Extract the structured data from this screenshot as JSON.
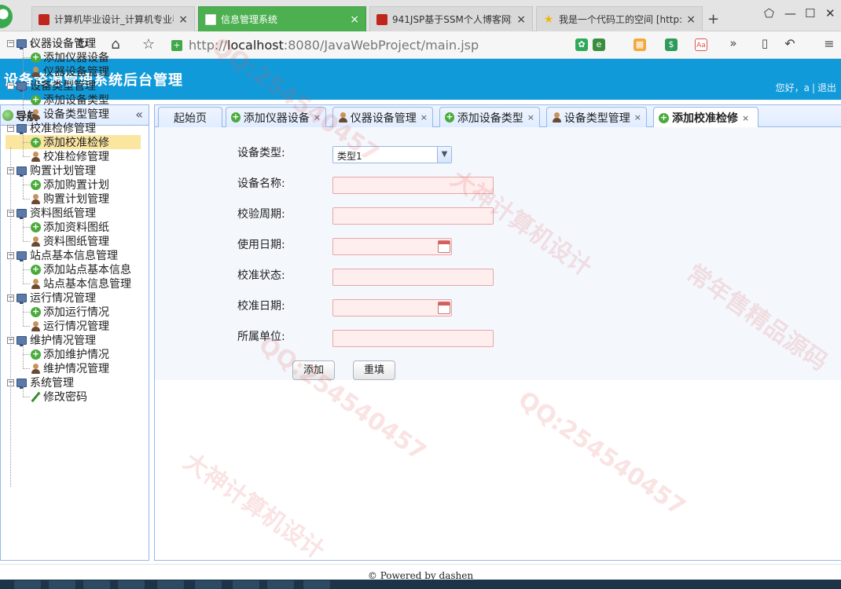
{
  "browser": {
    "tabs": [
      {
        "title": "计算机毕业设计_计算机专业毕",
        "favicon": "red-square-icon",
        "active": false
      },
      {
        "title": "信息管理系统",
        "favicon": "document-icon",
        "active": true
      },
      {
        "title": "941JSP基于SSM个人博客网站",
        "favicon": "red-square-icon",
        "active": false
      },
      {
        "title": "我是一个代码工的空间 [http:",
        "favicon": "star-icon",
        "active": false
      }
    ],
    "new_tab": "+",
    "url_prefix": "http://",
    "url_host": "localhost",
    "url_rest": ":8080/JavaWebProject/main.jsp"
  },
  "header": {
    "title": "设备资源管理系统后台管理",
    "greeting": "您好，a",
    "separator": "|",
    "logout": "退出"
  },
  "sidebar": {
    "title": "导航",
    "collapse": "«",
    "groups": [
      {
        "label": "仪器设备管理",
        "items": [
          {
            "label": "添加仪器设备",
            "icon": "add-icon"
          },
          {
            "label": "仪器设备管理",
            "icon": "user-icon"
          }
        ]
      },
      {
        "label": "设备类型管理",
        "items": [
          {
            "label": "添加设备类型",
            "icon": "add-icon"
          },
          {
            "label": "设备类型管理",
            "icon": "user-icon"
          }
        ]
      },
      {
        "label": "校准检修管理",
        "items": [
          {
            "label": "添加校准检修",
            "icon": "add-icon"
          },
          {
            "label": "校准检修管理",
            "icon": "user-icon"
          }
        ]
      },
      {
        "label": "购置计划管理",
        "items": [
          {
            "label": "添加购置计划",
            "icon": "add-icon"
          },
          {
            "label": "购置计划管理",
            "icon": "user-icon"
          }
        ]
      },
      {
        "label": "资料图纸管理",
        "items": [
          {
            "label": "添加资料图纸",
            "icon": "add-icon"
          },
          {
            "label": "资料图纸管理",
            "icon": "user-icon"
          }
        ]
      },
      {
        "label": "站点基本信息管理",
        "items": [
          {
            "label": "添加站点基本信息",
            "icon": "add-icon"
          },
          {
            "label": "站点基本信息管理",
            "icon": "user-icon"
          }
        ]
      },
      {
        "label": "运行情况管理",
        "items": [
          {
            "label": "添加运行情况",
            "icon": "add-icon"
          },
          {
            "label": "运行情况管理",
            "icon": "user-icon"
          }
        ]
      },
      {
        "label": "维护情况管理",
        "items": [
          {
            "label": "添加维护情况",
            "icon": "add-icon"
          },
          {
            "label": "维护情况管理",
            "icon": "user-icon"
          }
        ]
      },
      {
        "label": "系统管理",
        "items": [
          {
            "label": "修改密码",
            "icon": "pencil-icon"
          }
        ]
      }
    ],
    "selected": "添加校准检修"
  },
  "content_tabs": [
    {
      "label": "起始页",
      "icon": "",
      "closable": false
    },
    {
      "label": "添加仪器设备",
      "icon": "add-icon",
      "closable": true
    },
    {
      "label": "仪器设备管理",
      "icon": "user-icon",
      "closable": true
    },
    {
      "label": "添加设备类型",
      "icon": "add-icon",
      "closable": true
    },
    {
      "label": "设备类型管理",
      "icon": "user-icon",
      "closable": true
    },
    {
      "label": "添加校准检修",
      "icon": "add-icon",
      "closable": true,
      "active": true
    }
  ],
  "form": {
    "fields": [
      {
        "label": "设备类型:",
        "type": "select",
        "value": "类型1"
      },
      {
        "label": "设备名称:",
        "type": "text",
        "value": ""
      },
      {
        "label": "校验周期:",
        "type": "text",
        "value": ""
      },
      {
        "label": "使用日期:",
        "type": "date",
        "value": ""
      },
      {
        "label": "校准状态:",
        "type": "text",
        "value": ""
      },
      {
        "label": "校准日期:",
        "type": "date",
        "value": ""
      },
      {
        "label": "所属单位:",
        "type": "text",
        "value": ""
      }
    ],
    "submit": "添加",
    "reset": "重填"
  },
  "footer": "© Powered by dashen",
  "watermarks": [
    "QQ:254540457",
    "大神计算机设计",
    "常年售精品源码"
  ],
  "colors": {
    "header": "#119ad9",
    "active_browser_tab": "#4caf50",
    "selected_node": "#fbe6a0",
    "invalid_input": "#ffeeee"
  }
}
